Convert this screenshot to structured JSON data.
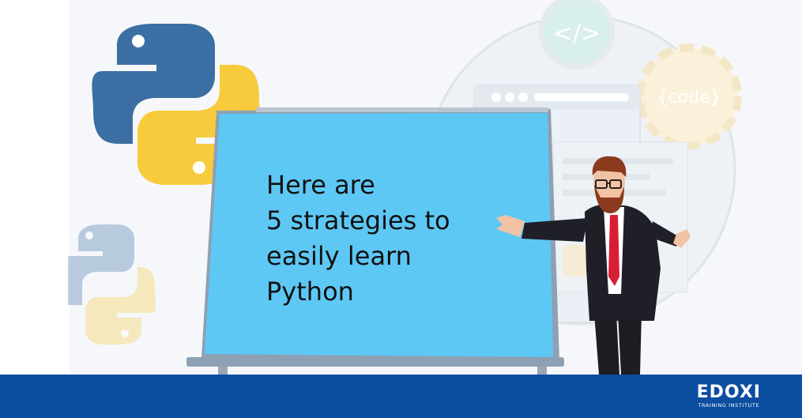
{
  "board": {
    "line1": "Here are",
    "line2": "5 strategies to",
    "line3": "easily learn",
    "line4": "Python"
  },
  "decor": {
    "code_tag": "</>",
    "code_gear": "{code}"
  },
  "footer": {
    "brand": "EDOXI",
    "tagline": "TRAINING INSTITUTE"
  },
  "colors": {
    "board": "#5ec8f5",
    "footer": "#0c4ea0",
    "python_blue": "#3b6fa3",
    "python_yellow": "#f7cb3c"
  },
  "icons": [
    "python-logo-icon",
    "code-tag-icon",
    "code-gear-icon",
    "browser-window-icon",
    "presenter-illustration"
  ]
}
